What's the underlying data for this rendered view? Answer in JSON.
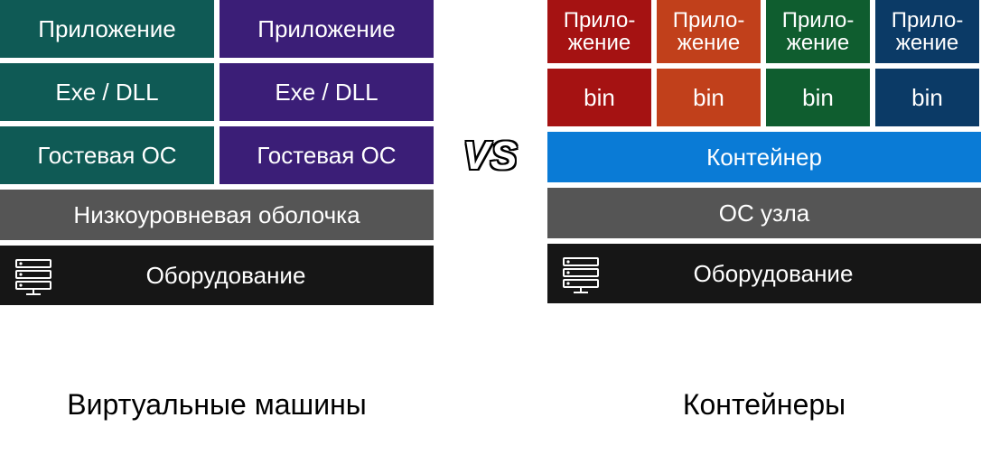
{
  "vs": "VS",
  "vm_side": {
    "title": "Виртуальные машины",
    "vm1": {
      "app": "Приложение",
      "bin": "Exe / DLL",
      "guest_os": "Гостевая ОС"
    },
    "vm2": {
      "app": "Приложение",
      "bin": "Exe / DLL",
      "guest_os": "Гостевая ОС"
    },
    "hypervisor": "Низкоуровневая оболочка",
    "hardware": "Оборудование"
  },
  "container_side": {
    "title": "Контейнеры",
    "apps": [
      {
        "app": "Прило-\nжение",
        "bin": "bin"
      },
      {
        "app": "Прило-\nжение",
        "bin": "bin"
      },
      {
        "app": "Прило-\nжение",
        "bin": "bin"
      },
      {
        "app": "Прило-\nжение",
        "bin": "bin"
      }
    ],
    "container": "Контейнер",
    "host_os": "ОС узла",
    "hardware": "Оборудование"
  },
  "colors": {
    "vm1": "#0f5a55",
    "vm2": "#3b1e77",
    "app_red": "#a51212",
    "app_orange": "#c1401b",
    "app_green": "#0f5d2f",
    "app_navy": "#0b3a66",
    "container": "#0a7bd6",
    "gray": "#555555",
    "hardware": "#161616"
  }
}
